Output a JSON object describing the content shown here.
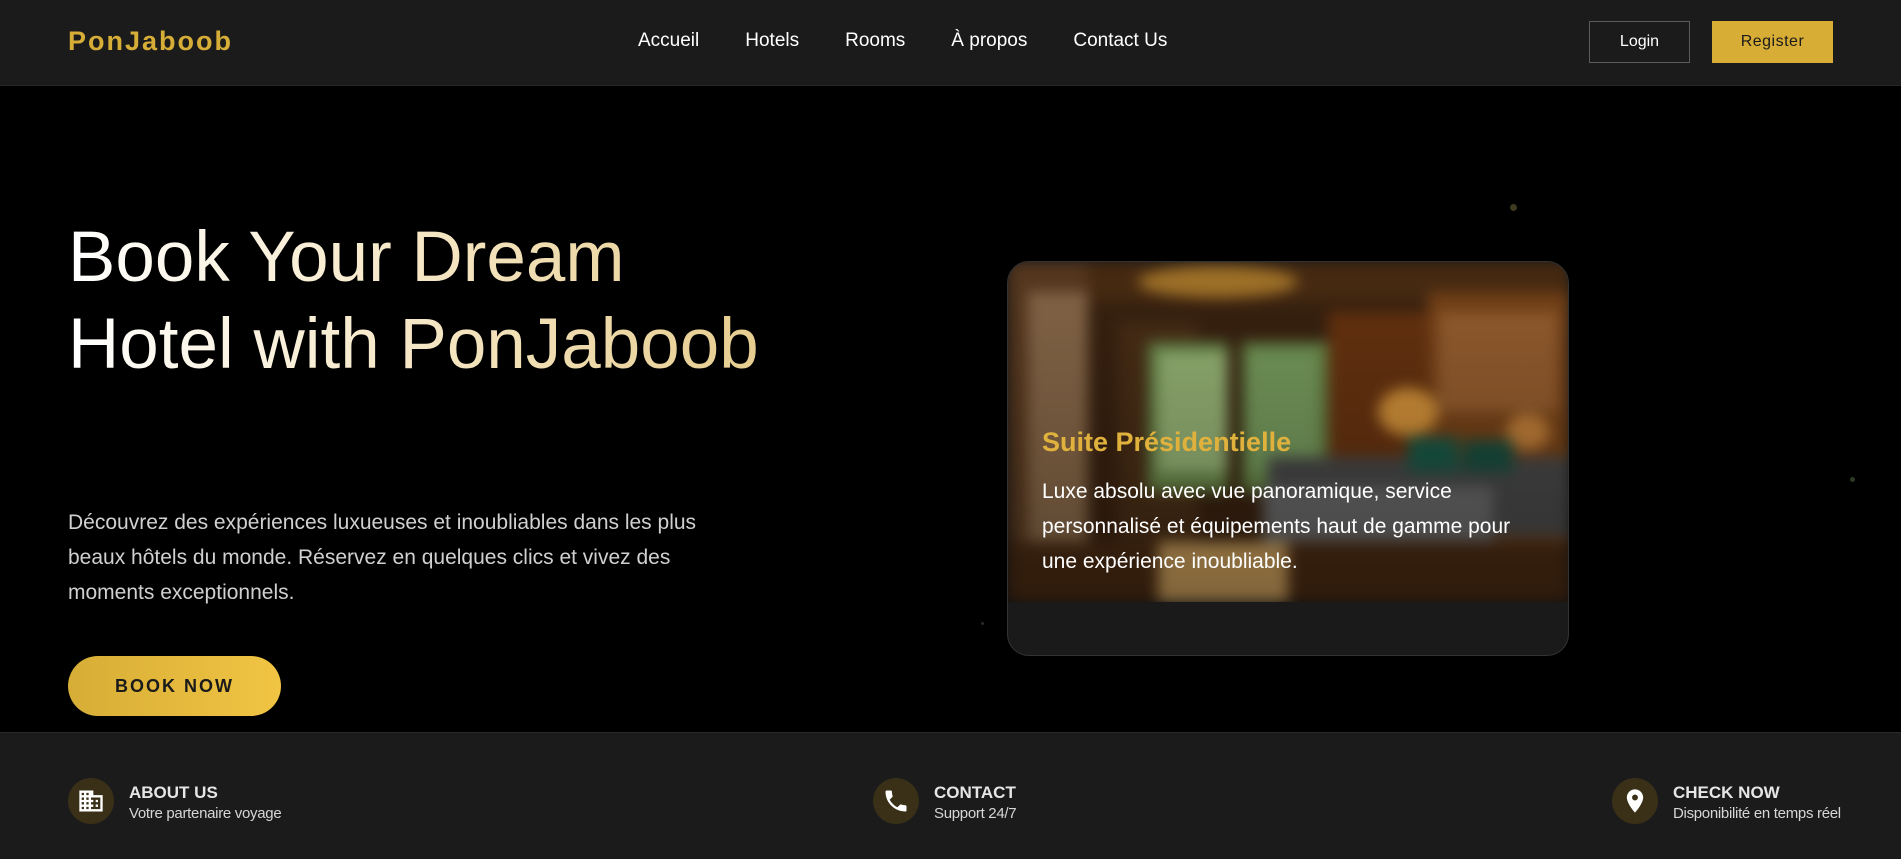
{
  "header": {
    "brand": "PonJaboob",
    "nav": [
      "Accueil",
      "Hotels",
      "Rooms",
      "À propos",
      "Contact Us"
    ],
    "login_label": "Login",
    "register_label": "Register"
  },
  "hero": {
    "title": "Book Your Dream Hotel with PonJaboob",
    "description": "Découvrez des expériences luxueuses et inoubliables dans les plus beaux hôtels du monde. Réservez en quelques clics et vivez des moments exceptionnels.",
    "cta_label": "BOOK NOW"
  },
  "card": {
    "title": "Suite Présidentielle",
    "description": "Luxe absolu avec vue panoramique, service personnalisé et équipements haut de gamme pour une expérience inoubliable."
  },
  "features": [
    {
      "icon": "building-icon",
      "title": "ABOUT US",
      "subtitle": "Votre partenaire voyage"
    },
    {
      "icon": "phone-icon",
      "title": "CONTACT",
      "subtitle": "Support 24/7"
    },
    {
      "icon": "location-pin-icon",
      "title": "CHECK NOW",
      "subtitle": "Disponibilité en temps réel"
    }
  ],
  "colors": {
    "accent": "#d6ad36",
    "background": "#000000",
    "panel": "#1b1b1b"
  }
}
